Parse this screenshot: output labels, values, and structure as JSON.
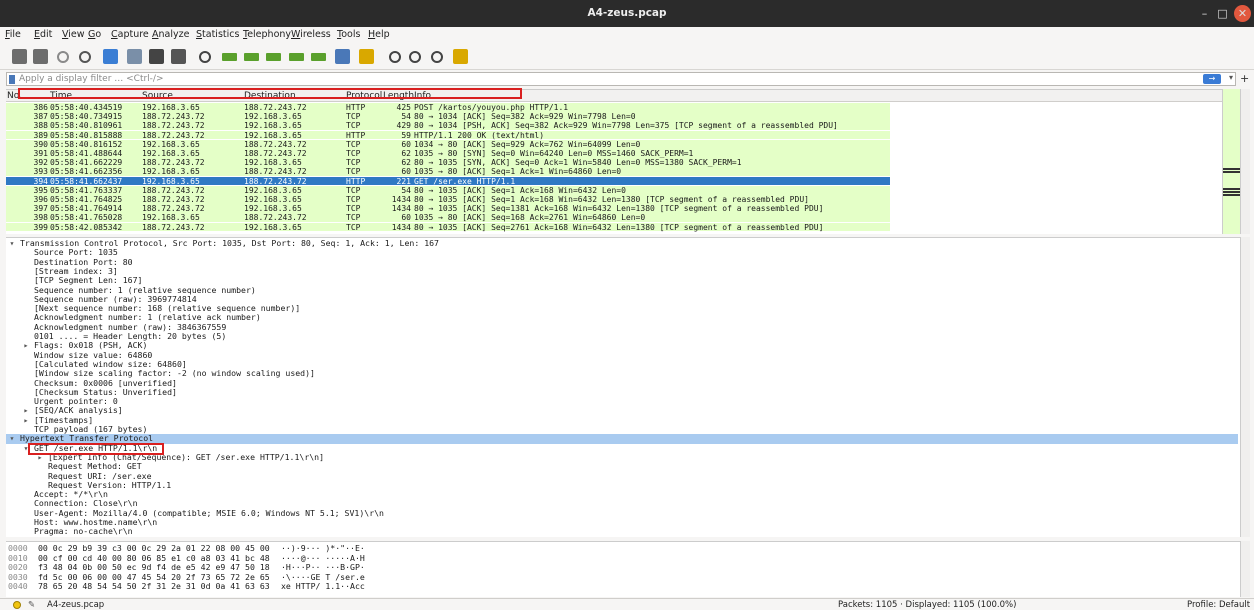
{
  "window": {
    "title": "A4-zeus.pcap",
    "minimize": "–",
    "maximize": "□",
    "close": "✕"
  },
  "menu": [
    "File",
    "Edit",
    "View",
    "Go",
    "Capture",
    "Analyze",
    "Statistics",
    "Telephony",
    "Wireless",
    "Tools",
    "Help"
  ],
  "toolbar": [
    {
      "name": "start-capture-icon",
      "color": "#6d6d6d"
    },
    {
      "name": "stop-capture-icon",
      "color": "#6d6d6d"
    },
    {
      "name": "restart-capture-icon",
      "color": "#8a8a8a"
    },
    {
      "name": "capture-options-icon",
      "color": "#555555"
    },
    {
      "name": "open-file-icon",
      "color": "#3b7ed4"
    },
    {
      "name": "save-file-icon",
      "color": "#7a8fa8"
    },
    {
      "name": "close-file-icon",
      "color": "#444444"
    },
    {
      "name": "reload-file-icon",
      "color": "#555555"
    },
    {
      "name": "find-packet-icon",
      "color": "#444444"
    },
    {
      "name": "go-back-icon",
      "color": "#5aa02c"
    },
    {
      "name": "go-forward-icon",
      "color": "#5aa02c"
    },
    {
      "name": "go-to-packet-icon",
      "color": "#5aa02c"
    },
    {
      "name": "go-first-icon",
      "color": "#5aa02c"
    },
    {
      "name": "go-last-icon",
      "color": "#5aa02c"
    },
    {
      "name": "autoscroll-icon",
      "color": "#4a78b8"
    },
    {
      "name": "colorize-icon",
      "color": "#d9a800"
    },
    {
      "name": "zoom-in-icon",
      "color": "#444444"
    },
    {
      "name": "zoom-out-icon",
      "color": "#444444"
    },
    {
      "name": "zoom-normal-icon",
      "color": "#444444"
    },
    {
      "name": "resize-columns-icon",
      "color": "#d9a800"
    }
  ],
  "filter": {
    "placeholder": "Apply a display filter … <Ctrl-/>",
    "apply": "→",
    "dropdown": "▾",
    "add": "+"
  },
  "packet_list": {
    "columns": [
      "No.",
      "Time",
      "Source",
      "Destination",
      "Protocol",
      "Length",
      "Info"
    ],
    "rows": [
      {
        "no": "386",
        "time": "05:58:40.434519",
        "src": "192.168.3.65",
        "dst": "188.72.243.72",
        "proto": "HTTP",
        "len": "425",
        "info": "POST /kartos/youyou.php HTTP/1.1"
      },
      {
        "no": "387",
        "time": "05:58:40.734915",
        "src": "188.72.243.72",
        "dst": "192.168.3.65",
        "proto": "TCP",
        "len": "54",
        "info": "80 → 1034 [ACK] Seq=382 Ack=929 Win=7798 Len=0"
      },
      {
        "no": "388",
        "time": "05:58:40.810961",
        "src": "188.72.243.72",
        "dst": "192.168.3.65",
        "proto": "TCP",
        "len": "429",
        "info": "80 → 1034 [PSH, ACK] Seq=382 Ack=929 Win=7798 Len=375 [TCP segment of a reassembled PDU]"
      },
      {
        "no": "389",
        "time": "05:58:40.815888",
        "src": "188.72.243.72",
        "dst": "192.168.3.65",
        "proto": "HTTP",
        "len": "59",
        "info": "HTTP/1.1 200 OK  (text/html)"
      },
      {
        "no": "390",
        "time": "05:58:40.816152",
        "src": "192.168.3.65",
        "dst": "188.72.243.72",
        "proto": "TCP",
        "len": "60",
        "info": "1034 → 80 [ACK] Seq=929 Ack=762 Win=64099 Len=0"
      },
      {
        "no": "391",
        "time": "05:58:41.488644",
        "src": "192.168.3.65",
        "dst": "188.72.243.72",
        "proto": "TCP",
        "len": "62",
        "info": "1035 → 80 [SYN] Seq=0 Win=64240 Len=0 MSS=1460 SACK_PERM=1"
      },
      {
        "no": "392",
        "time": "05:58:41.662229",
        "src": "188.72.243.72",
        "dst": "192.168.3.65",
        "proto": "TCP",
        "len": "62",
        "info": "80 → 1035 [SYN, ACK] Seq=0 Ack=1 Win=5840 Len=0 MSS=1380 SACK_PERM=1"
      },
      {
        "no": "393",
        "time": "05:58:41.662356",
        "src": "192.168.3.65",
        "dst": "188.72.243.72",
        "proto": "TCP",
        "len": "60",
        "info": "1035 → 80 [ACK] Seq=1 Ack=1 Win=64860 Len=0"
      },
      {
        "no": "394",
        "time": "05:58:41.662437",
        "src": "192.168.3.65",
        "dst": "188.72.243.72",
        "proto": "HTTP",
        "len": "221",
        "info": "GET /ser.exe HTTP/1.1"
      },
      {
        "no": "395",
        "time": "05:58:41.763337",
        "src": "188.72.243.72",
        "dst": "192.168.3.65",
        "proto": "TCP",
        "len": "54",
        "info": "80 → 1035 [ACK] Seq=1 Ack=168 Win=6432 Len=0"
      },
      {
        "no": "396",
        "time": "05:58:41.764825",
        "src": "188.72.243.72",
        "dst": "192.168.3.65",
        "proto": "TCP",
        "len": "1434",
        "info": "80 → 1035 [ACK] Seq=1 Ack=168 Win=6432 Len=1380 [TCP segment of a reassembled PDU]"
      },
      {
        "no": "397",
        "time": "05:58:41.764914",
        "src": "188.72.243.72",
        "dst": "192.168.3.65",
        "proto": "TCP",
        "len": "1434",
        "info": "80 → 1035 [ACK] Seq=1381 Ack=168 Win=6432 Len=1380 [TCP segment of a reassembled PDU]"
      },
      {
        "no": "398",
        "time": "05:58:41.765028",
        "src": "192.168.3.65",
        "dst": "188.72.243.72",
        "proto": "TCP",
        "len": "60",
        "info": "1035 → 80 [ACK] Seq=168 Ack=2761 Win=64860 Len=0"
      },
      {
        "no": "399",
        "time": "05:58:42.085342",
        "src": "188.72.243.72",
        "dst": "192.168.3.65",
        "proto": "TCP",
        "len": "1434",
        "info": "80 → 1035 [ACK] Seq=2761 Ack=168 Win=6432 Len=1380 [TCP segment of a reassembled PDU]"
      }
    ],
    "selected_index": 8
  },
  "details": [
    {
      "indent": 0,
      "arrow": "▾",
      "text": "Transmission Control Protocol, Src Port: 1035, Dst Port: 80, Seq: 1, Ack: 1, Len: 167"
    },
    {
      "indent": 1,
      "arrow": "",
      "text": "Source Port: 1035"
    },
    {
      "indent": 1,
      "arrow": "",
      "text": "Destination Port: 80"
    },
    {
      "indent": 1,
      "arrow": "",
      "text": "[Stream index: 3]"
    },
    {
      "indent": 1,
      "arrow": "",
      "text": "[TCP Segment Len: 167]"
    },
    {
      "indent": 1,
      "arrow": "",
      "text": "Sequence number: 1    (relative sequence number)"
    },
    {
      "indent": 1,
      "arrow": "",
      "text": "Sequence number (raw): 3969774814"
    },
    {
      "indent": 1,
      "arrow": "",
      "text": "[Next sequence number: 168    (relative sequence number)]"
    },
    {
      "indent": 1,
      "arrow": "",
      "text": "Acknowledgment number: 1    (relative ack number)"
    },
    {
      "indent": 1,
      "arrow": "",
      "text": "Acknowledgment number (raw): 3846367559"
    },
    {
      "indent": 1,
      "arrow": "",
      "text": "0101 .... = Header Length: 20 bytes (5)"
    },
    {
      "indent": 1,
      "arrow": "▸",
      "text": "Flags: 0x018 (PSH, ACK)"
    },
    {
      "indent": 1,
      "arrow": "",
      "text": "Window size value: 64860"
    },
    {
      "indent": 1,
      "arrow": "",
      "text": "[Calculated window size: 64860]"
    },
    {
      "indent": 1,
      "arrow": "",
      "text": "[Window size scaling factor: -2 (no window scaling used)]"
    },
    {
      "indent": 1,
      "arrow": "",
      "text": "Checksum: 0x0006 [unverified]"
    },
    {
      "indent": 1,
      "arrow": "",
      "text": "[Checksum Status: Unverified]"
    },
    {
      "indent": 1,
      "arrow": "",
      "text": "Urgent pointer: 0"
    },
    {
      "indent": 1,
      "arrow": "▸",
      "text": "[SEQ/ACK analysis]"
    },
    {
      "indent": 1,
      "arrow": "▸",
      "text": "[Timestamps]"
    },
    {
      "indent": 1,
      "arrow": "",
      "text": "TCP payload (167 bytes)"
    },
    {
      "indent": 0,
      "arrow": "▾",
      "text": "Hypertext Transfer Protocol",
      "hl": true
    },
    {
      "indent": 1,
      "arrow": "▾",
      "text": "GET /ser.exe HTTP/1.1\\r\\n"
    },
    {
      "indent": 2,
      "arrow": "▸",
      "text": "[Expert Info (Chat/Sequence): GET /ser.exe HTTP/1.1\\r\\n]"
    },
    {
      "indent": 2,
      "arrow": "",
      "text": "Request Method: GET"
    },
    {
      "indent": 2,
      "arrow": "",
      "text": "Request URI: /ser.exe"
    },
    {
      "indent": 2,
      "arrow": "",
      "text": "Request Version: HTTP/1.1"
    },
    {
      "indent": 1,
      "arrow": "",
      "text": "Accept: */*\\r\\n"
    },
    {
      "indent": 1,
      "arrow": "",
      "text": "Connection: Close\\r\\n"
    },
    {
      "indent": 1,
      "arrow": "",
      "text": "User-Agent: Mozilla/4.0 (compatible; MSIE 6.0; Windows NT 5.1; SV1)\\r\\n"
    },
    {
      "indent": 1,
      "arrow": "",
      "text": "Host: www.hostme.name\\r\\n"
    },
    {
      "indent": 1,
      "arrow": "",
      "text": "Pragma: no-cache\\r\\n"
    }
  ],
  "bytes": [
    {
      "off": "0000",
      "hex": "00 0c 29 b9 39 c3 00 0c  29 2a 01 22 08 00 45 00",
      "ascii": "··)·9··· )*·\"··E·"
    },
    {
      "off": "0010",
      "hex": "00 cf 00 cd 40 00 80 06  85 e1 c0 a8 03 41 bc 48",
      "ascii": "····@··· ·····A·H"
    },
    {
      "off": "0020",
      "hex": "f3 48 04 0b 00 50 ec 9d  f4 de e5 42 e9 47 50 18",
      "ascii": "·H···P·· ···B·GP·"
    },
    {
      "off": "0030",
      "hex": "fd 5c 00 06 00 00 47 45  54 20 2f 73 65 72 2e 65",
      "ascii": "·\\····GE T /ser.e"
    },
    {
      "off": "0040",
      "hex": "78 65 20 48 54 54 50 2f  31 2e 31 0d 0a 41 63 63",
      "ascii": "xe HTTP/ 1.1··Acc"
    }
  ],
  "status": {
    "file": "A4-zeus.pcap",
    "packets": "Packets: 1105 · Displayed: 1105 (100.0%)",
    "profile": "Profile: Default"
  }
}
